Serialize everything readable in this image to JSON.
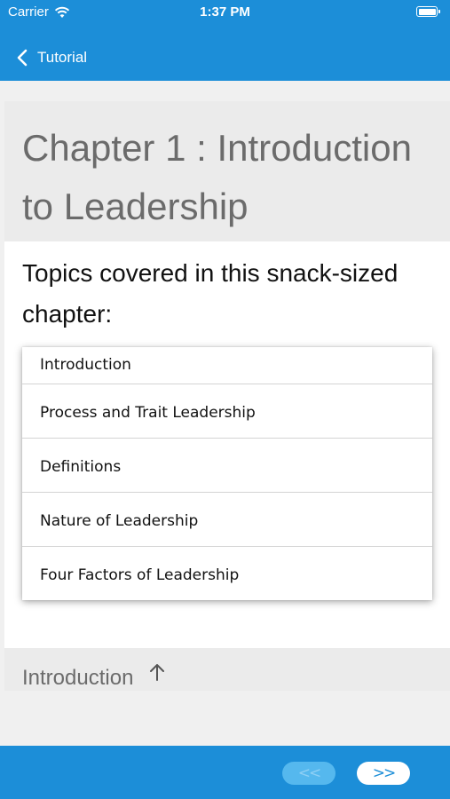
{
  "status_bar": {
    "carrier": "Carrier",
    "time": "1:37 PM"
  },
  "nav": {
    "back_label": "Tutorial"
  },
  "chapter": {
    "title": "Chapter 1 : Introduction to Leadership",
    "topics_intro": "Topics covered in this snack-sized chapter:"
  },
  "topics": [
    "Introduction",
    "Process and Trait Leadership",
    "Definitions",
    "Nature of Leadership",
    "Four Factors of Leadership"
  ],
  "section": {
    "title": "Introduction",
    "icon": "up-arrow-icon"
  },
  "toolbar": {
    "prev_label": "<<",
    "next_label": ">>"
  },
  "colors": {
    "primary": "#1c8ed8",
    "disabled_button": "#55b8ee",
    "title_gray": "#6b6b6b"
  }
}
